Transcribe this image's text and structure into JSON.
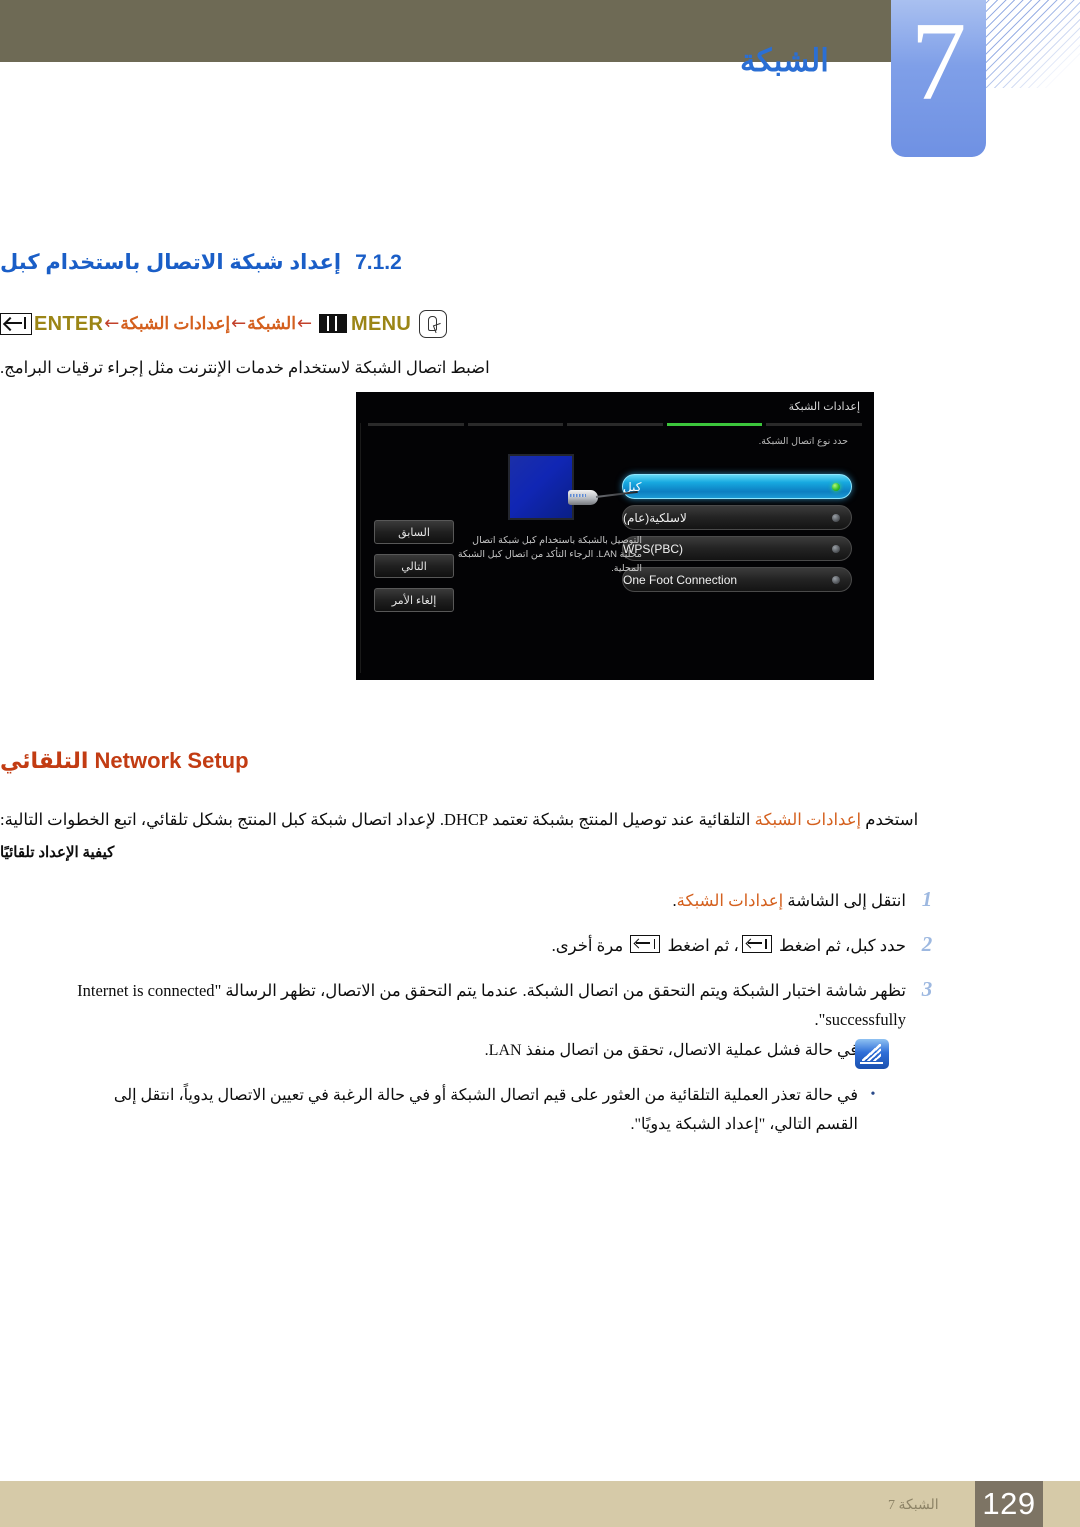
{
  "header": {
    "chapter_number": "7",
    "chapter_title": "الشبكة",
    "accent_blue": "#6f91e3"
  },
  "section": {
    "number": "7.1.2",
    "title": "إعداد شبكة الاتصال باستخدام كبل",
    "heading_color": "#1a5ec7"
  },
  "breadcrumb": {
    "hand_icon": "hand-press-icon",
    "menu_label": "MENU",
    "menu_icon": "menu-bars-icon",
    "arrow": "←",
    "path_network": "الشبكة",
    "path_network_settings": "إعدادات الشبكة",
    "enter_label": "ENTER",
    "enter_icon": "enter-key-icon"
  },
  "intro": {
    "text": "اضبط اتصال الشبكة لاستخدام خدمات الإنترنت مثل إجراء ترقيات البرامج."
  },
  "tv_screen": {
    "title": "إعدادات الشبكة",
    "subtitle": "حدد نوع اتصال الشبكة.",
    "progress_steps": 5,
    "progress_active_index": 1,
    "menu_items": [
      {
        "label": "كبل",
        "selected": true
      },
      {
        "label": "لاسلكية(عام)",
        "selected": false
      },
      {
        "label": "WPS(PBC)",
        "selected": false
      },
      {
        "label": "One Foot Connection",
        "selected": false
      }
    ],
    "description": "التوصيل بالشبكة باستخدام كبل شبكة اتصال محلية LAN. الرجاء التأكد من اتصال كبل الشبكة المحلية.",
    "buttons": [
      {
        "label": "السابق"
      },
      {
        "label": "التالي"
      },
      {
        "label": "إلغاء الأمر"
      }
    ],
    "illustration": "lan-port-and-cable-icon"
  },
  "auto_setup": {
    "heading_en": "Network Setup",
    "heading_ar": "التلقائي",
    "heading_color": "#c23c13",
    "paragraph_part1": "استخدم ",
    "paragraph_link": "إعدادات الشبكة",
    "paragraph_part2": " التلقائية عند توصيل المنتج بشبكة تعتمد DHCP. لإعداد اتصال شبكة كبل المنتج بشكل تلقائي، اتبع الخطوات التالية:",
    "how_to_label": "كيفية الإعداد تلقائيًا",
    "steps": [
      {
        "number": "1",
        "text_before": "انتقل إلى الشاشة ",
        "link": "إعدادات الشبكة",
        "text_after": "."
      },
      {
        "number": "2",
        "text_a": "حدد كبل، ثم اضغط ",
        "text_b": "، ثم اضغط ",
        "text_c": " مرة أخرى."
      },
      {
        "number": "3",
        "text_line1": "تظهر شاشة اختبار الشبكة ويتم التحقق من اتصال الشبكة. عندما يتم التحقق من الاتصال، تظهر الرسالة \"Internet is connected",
        "text_line2": "successfully\"."
      }
    ],
    "notes_icon": "note-pencil-icon",
    "notes": [
      {
        "bullet": "•",
        "text": "في حالة فشل عملية الاتصال، تحقق من اتصال منفذ LAN."
      },
      {
        "bullet": "•",
        "text": "في حالة تعذر العملية التلقائية من العثور على قيم اتصال الشبكة أو في حالة الرغبة في تعيين الاتصال يدوياً، انتقل إلى القسم التالي، \"إعداد الشبكة يدويًا\"."
      }
    ]
  },
  "footer": {
    "label": "الشبكة 7",
    "page_number": "129",
    "bar_color": "#d6caa8",
    "page_box_color": "#7d7464"
  }
}
